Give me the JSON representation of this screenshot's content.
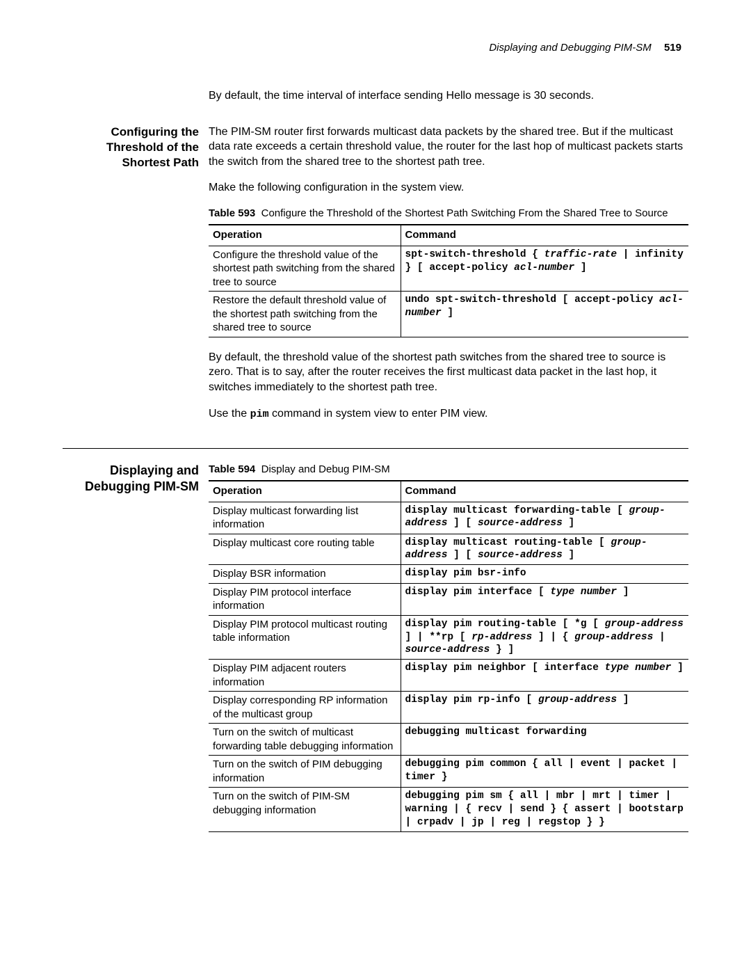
{
  "runningHead": {
    "title": "Displaying and Debugging PIM-SM",
    "page": "519"
  },
  "intro": "By default, the time interval of interface sending Hello message is 30 seconds.",
  "section1": {
    "heading": "Configuring the Threshold of the Shortest Path",
    "p1": "The PIM-SM router first forwards multicast data packets by the shared tree. But if the multicast data rate exceeds a certain threshold value, the router for the last hop of multicast packets starts the switch from the shared tree to the shortest path tree.",
    "p2": "Make the following configuration in the system view.",
    "tableLabelBold": "Table 593",
    "tableLabelRest": "Configure the Threshold of the Shortest Path Switching From the Shared Tree to Source",
    "th1": "Operation",
    "th2": "Command",
    "rows": [
      {
        "op": "Configure the threshold value of the shortest path switching from the shared tree to source"
      },
      {
        "op": "Restore the default threshold value of the shortest path switching from the shared tree to source"
      }
    ],
    "p3": "By default, the threshold value of the shortest path switches from the shared tree to source is zero. That is to say, after the router receives the first multicast data packet in the last hop, it switches immediately to the shortest path tree.",
    "p4a": "Use the ",
    "p4cmd": "pim",
    "p4b": " command in system view to enter PIM view."
  },
  "section2": {
    "heading": "Displaying and Debugging PIM-SM",
    "tableLabelBold": "Table 594",
    "tableLabelRest": "Display and Debug PIM-SM",
    "th1": "Operation",
    "th2": "Command",
    "rows": [
      {
        "op": "Display multicast forwarding list information"
      },
      {
        "op": "Display multicast core routing table"
      },
      {
        "op": "Display BSR information"
      },
      {
        "op": "Display PIM protocol interface information"
      },
      {
        "op": "Display PIM protocol multicast routing table information"
      },
      {
        "op": "Display PIM adjacent routers information"
      },
      {
        "op": "Display corresponding RP information of the multicast group"
      },
      {
        "op": "Turn on the switch of multicast forwarding table debugging information"
      },
      {
        "op": "Turn on the switch of PIM debugging information"
      },
      {
        "op": "Turn on the switch of PIM-SM debugging information"
      }
    ]
  }
}
